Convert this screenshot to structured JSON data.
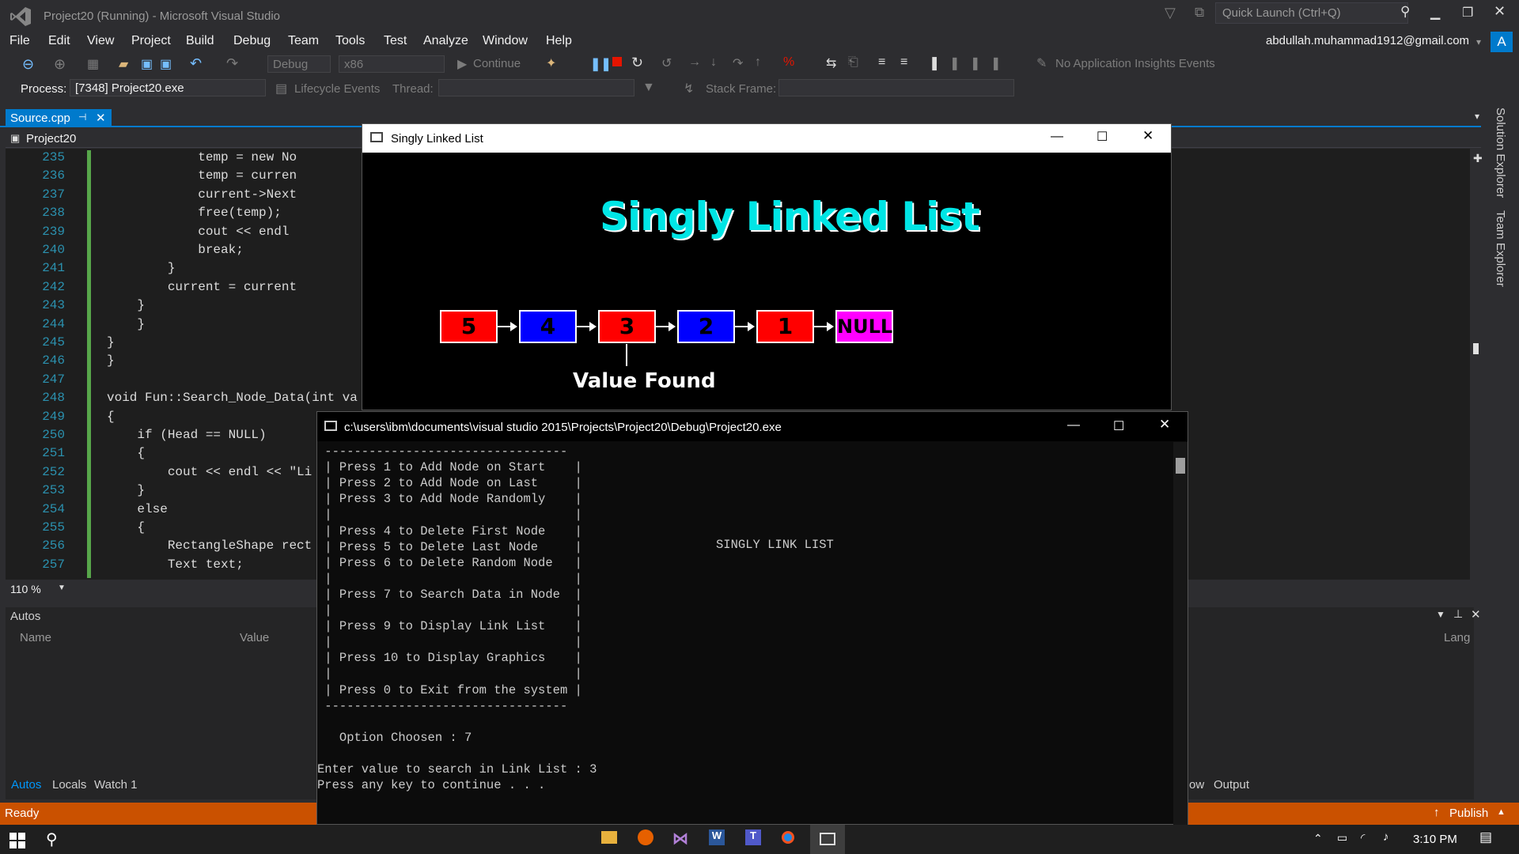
{
  "title": "Project20 (Running) - Microsoft Visual Studio",
  "quick_launch": "Quick Launch (Ctrl+Q)",
  "account": "abdullah.muhammad1912@gmail.com",
  "account_initial": "A",
  "menu": [
    "File",
    "Edit",
    "View",
    "Project",
    "Build",
    "Debug",
    "Team",
    "Tools",
    "Test",
    "Analyze",
    "Window",
    "Help"
  ],
  "toolbar": {
    "config": "Debug",
    "platform": "x86",
    "continue": "Continue",
    "insights": "No Application Insights Events"
  },
  "debug_bar": {
    "process_label": "Process:",
    "process_value": "[7348] Project20.exe",
    "lifecycle": "Lifecycle Events",
    "thread_label": "Thread:",
    "stack_label": "Stack Frame:"
  },
  "doc_tab": "Source.cpp",
  "nav_project": "Project20",
  "zoom": "110 %",
  "code_lines": [
    {
      "n": "235",
      "t": "            temp = new No"
    },
    {
      "n": "236",
      "t": "            temp = curren"
    },
    {
      "n": "237",
      "t": "            current->Next"
    },
    {
      "n": "238",
      "t": "            free(temp);"
    },
    {
      "n": "239",
      "t": "            cout << endl"
    },
    {
      "n": "240",
      "t": "            break;"
    },
    {
      "n": "241",
      "t": "        }"
    },
    {
      "n": "242",
      "t": "        current = current"
    },
    {
      "n": "243",
      "t": "    }"
    },
    {
      "n": "244",
      "t": "    }"
    },
    {
      "n": "245",
      "t": "}"
    },
    {
      "n": "246",
      "t": "}"
    },
    {
      "n": "247",
      "t": ""
    },
    {
      "n": "248",
      "t": "void Fun::Search_Node_Data(int va"
    },
    {
      "n": "249",
      "t": "{"
    },
    {
      "n": "250",
      "t": "    if (Head == NULL)"
    },
    {
      "n": "251",
      "t": "    {"
    },
    {
      "n": "252",
      "t": "        cout << endl << \"Li"
    },
    {
      "n": "253",
      "t": "    }"
    },
    {
      "n": "254",
      "t": "    else"
    },
    {
      "n": "255",
      "t": "    {"
    },
    {
      "n": "256",
      "t": "        RectangleShape rect"
    },
    {
      "n": "257",
      "t": "        Text text;"
    }
  ],
  "autos": {
    "title": "Autos",
    "col_name": "Name",
    "col_value": "Value",
    "col_lang": "Lang",
    "tabs": [
      "Autos",
      "Locals",
      "Watch 1"
    ],
    "right_tabs": [
      "ow",
      "Output"
    ]
  },
  "side_tabs": [
    "Solution Explorer",
    "Team Explorer"
  ],
  "status": {
    "ready": "Ready",
    "publish": "Publish"
  },
  "graphics_window": {
    "title": "Singly Linked List",
    "heading": "Singly Linked List",
    "nodes": [
      {
        "label": "5",
        "color": "#ff0000"
      },
      {
        "label": "4",
        "color": "#0000ff"
      },
      {
        "label": "3",
        "color": "#ff0000"
      },
      {
        "label": "2",
        "color": "#0000ff"
      },
      {
        "label": "1",
        "color": "#ff0000"
      },
      {
        "label": "NULL",
        "color": "#ff00ff"
      }
    ],
    "found_label": "Value Found"
  },
  "console_window": {
    "title": "c:\\users\\ibm\\documents\\visual studio 2015\\Projects\\Project20\\Debug\\Project20.exe",
    "lines": [
      " ---------------------------------",
      " | Press 1 to Add Node on Start    |",
      " | Press 2 to Add Node on Last     |",
      " | Press 3 to Add Node Randomly    |",
      " |                                 |",
      " | Press 4 to Delete First Node    |",
      " | Press 5 to Delete Last Node     |",
      " | Press 6 to Delete Random Node   |",
      " |                                 |",
      " | Press 7 to Search Data in Node  |",
      " |                                 |",
      " | Press 9 to Display Link List    |",
      " |                                 |",
      " | Press 10 to Display Graphics    |",
      " |                                 |",
      " | Press 0 to Exit from the system |",
      " ---------------------------------",
      "",
      "   Option Choosen : 7",
      "",
      "Enter value to search in Link List : 3",
      "Press any key to continue . . ."
    ],
    "side_heading": "SINGLY LINK LIST"
  },
  "clock": "3:10 PM"
}
